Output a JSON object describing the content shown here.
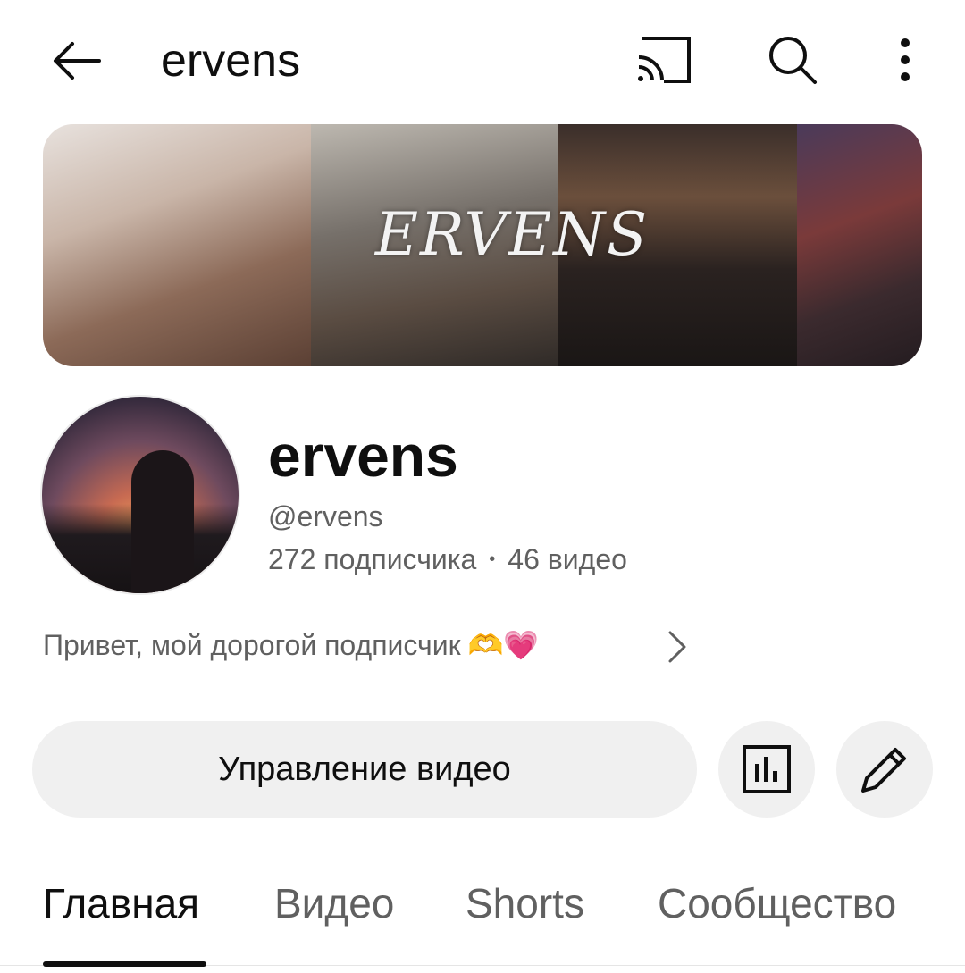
{
  "header": {
    "title": "ervens",
    "icons": [
      "back-arrow-icon",
      "cast-icon",
      "search-icon",
      "more-vert-icon"
    ]
  },
  "banner": {
    "wordmark": "ERVENS"
  },
  "channel": {
    "name": "ervens",
    "handle": "@ervens",
    "subscribers": "272 подписчика",
    "separator": "•",
    "videos": "46 видео",
    "description": "Привет, мой дорогой подписчик",
    "description_emojis": "🫶💗"
  },
  "actions": {
    "manage_label": "Управление видео",
    "icons": [
      "analytics-icon",
      "edit-pencil-icon"
    ]
  },
  "tabs": [
    {
      "label": "Главная",
      "active": true
    },
    {
      "label": "Видео",
      "active": false
    },
    {
      "label": "Shorts",
      "active": false
    },
    {
      "label": "Сообщество",
      "active": false
    }
  ],
  "colors": {
    "text_primary": "#0f0f0f",
    "text_secondary": "#606060",
    "button_bg": "#f0f0f0"
  }
}
